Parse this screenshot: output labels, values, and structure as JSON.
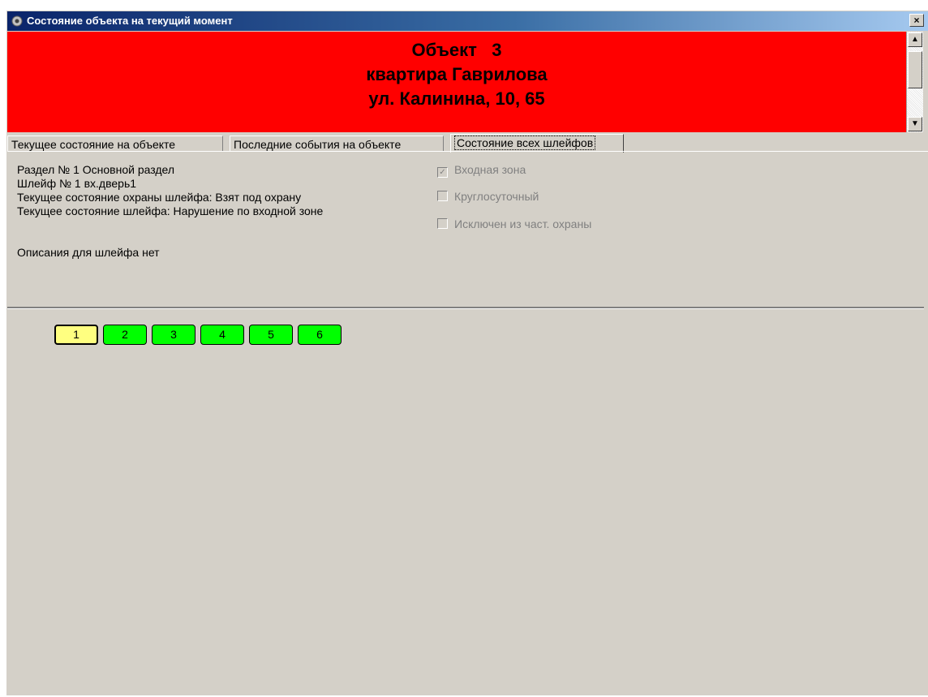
{
  "window": {
    "title": "Состояние объекта на текущий момент",
    "close_label": "×"
  },
  "header": {
    "background": "#ff0000",
    "line1": "Объект   3",
    "line2": "квартира Гаврилова",
    "line3": "ул. Калинина, 10, 65"
  },
  "scrollbar": {
    "up": "▲",
    "down": "▼"
  },
  "tabs": [
    {
      "label": "Текущее состояние на объекте"
    },
    {
      "label": "Последние события на объекте"
    },
    {
      "label": "Состояние всех шлейфов"
    }
  ],
  "info": {
    "section": "Раздел № 1   Основной раздел",
    "loop": "Шлейф № 1   вх.дверь1",
    "guard_state": "Текущее состояние охраны шлейфа:  Взят под охрану",
    "loop_state": "Текущее состояние шлейфа:  Нарушение по входной зоне",
    "description": "Описания для шлейфа нет"
  },
  "checkboxes": [
    {
      "label": "Входная зона",
      "checked": true,
      "mark": "✓"
    },
    {
      "label": "Круглосуточный",
      "checked": false,
      "mark": ""
    },
    {
      "label": "Исключен из част. охраны",
      "checked": false,
      "mark": ""
    }
  ],
  "loops": [
    {
      "label": "1",
      "selected": true,
      "color": "#ffff80"
    },
    {
      "label": "2",
      "selected": false,
      "color": "#00ff00"
    },
    {
      "label": "3",
      "selected": false,
      "color": "#00ff00"
    },
    {
      "label": "4",
      "selected": false,
      "color": "#00ff00"
    },
    {
      "label": "5",
      "selected": false,
      "color": "#00ff00"
    },
    {
      "label": "6",
      "selected": false,
      "color": "#00ff00"
    }
  ]
}
